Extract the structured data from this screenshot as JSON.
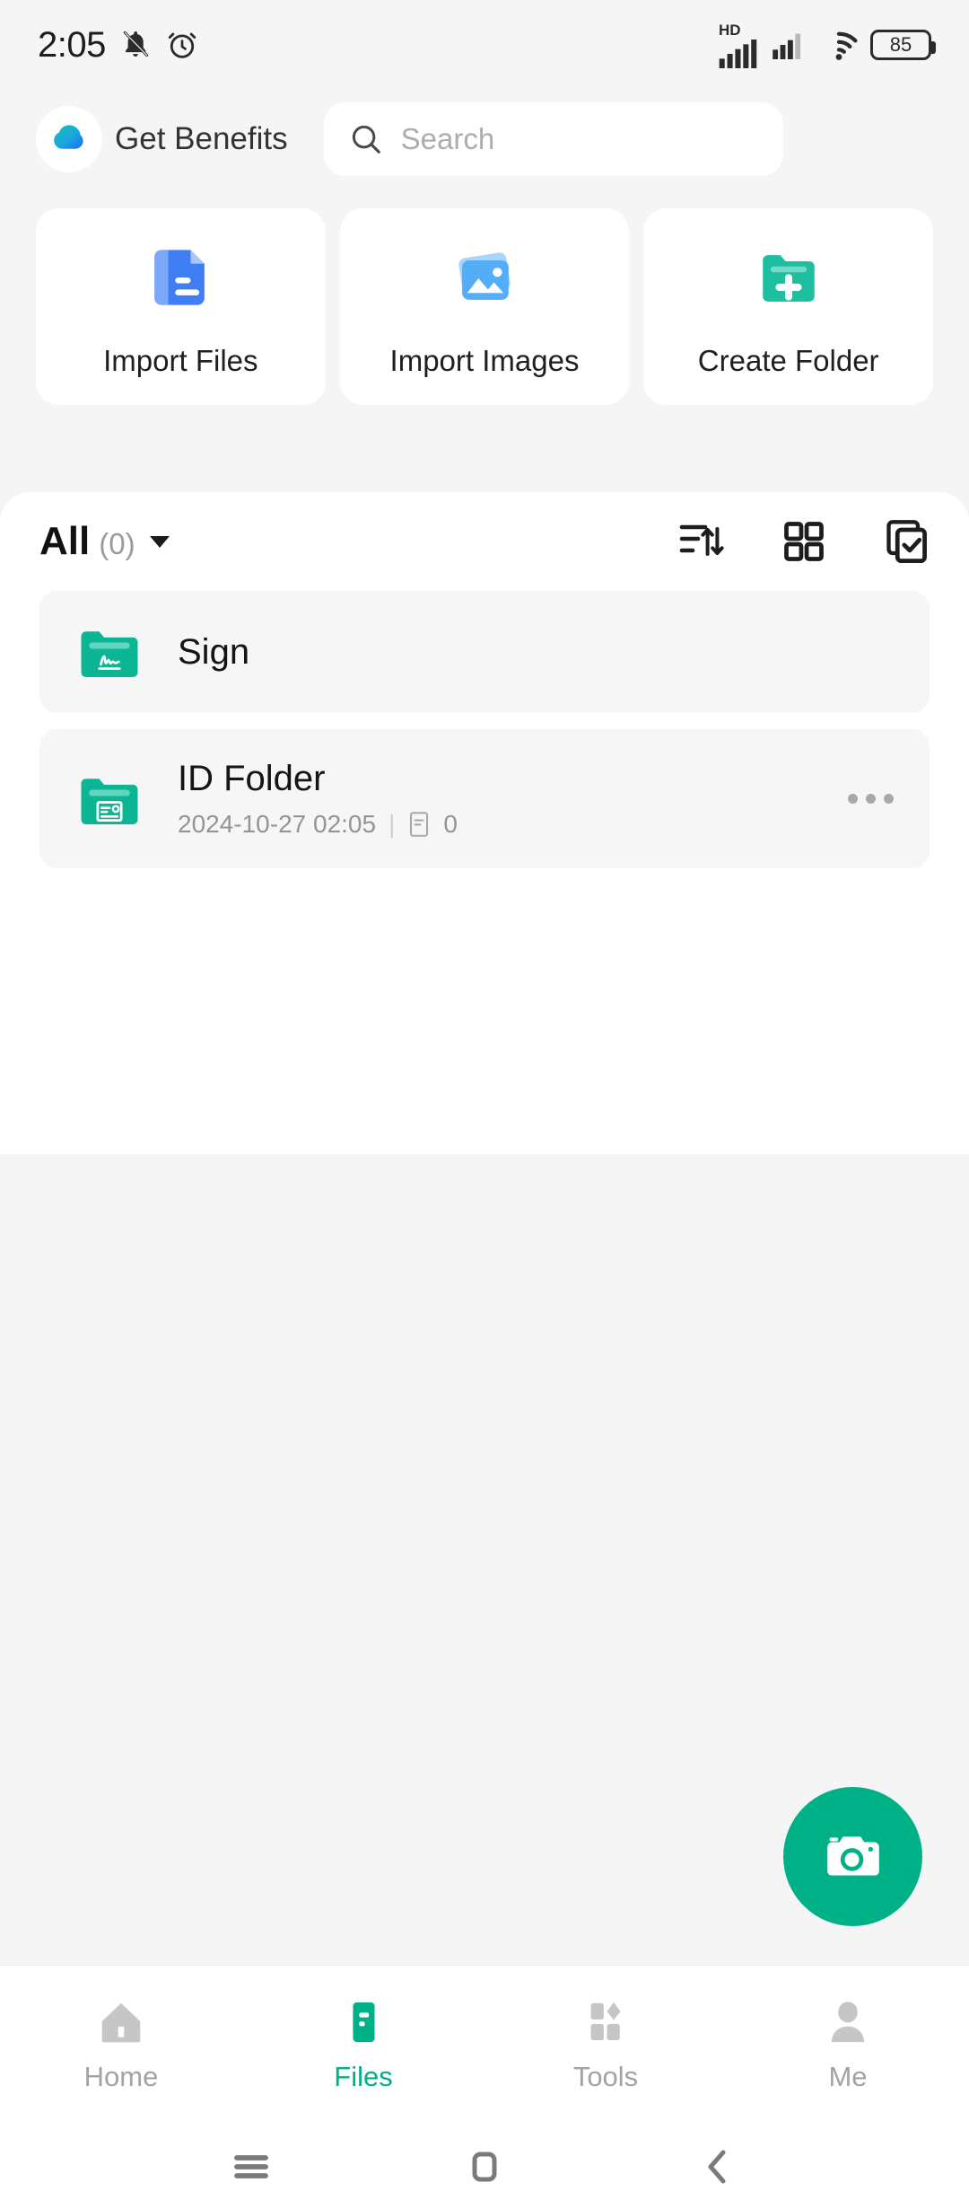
{
  "status_bar": {
    "time": "2:05",
    "left_icons": [
      "silent-bell-icon",
      "alarm-icon"
    ],
    "network_label": "HD",
    "right_icons": [
      "signal-bars-icon",
      "signal-bars-2-icon",
      "wifi-icon"
    ],
    "battery_level": "85"
  },
  "header": {
    "brand_icon": "cloud-icon",
    "brand_label": "Get Benefits",
    "search_placeholder": "Search",
    "search_value": "",
    "search_icon": "search-icon"
  },
  "action_cards": [
    {
      "label": "Import Files",
      "icon": "document-icon"
    },
    {
      "label": "Import Images",
      "icon": "photos-icon"
    },
    {
      "label": "Create Folder",
      "icon": "folder-plus-icon"
    }
  ],
  "filter_bar": {
    "label": "All",
    "count": "(0)",
    "caret_icon": "chevron-down-icon",
    "actions": [
      {
        "name": "sort-icon"
      },
      {
        "name": "grid-view-icon"
      },
      {
        "name": "multi-select-icon"
      }
    ]
  },
  "files": [
    {
      "name": "Sign",
      "icon": "folder-sign-icon",
      "meta_date": "",
      "meta_count": "",
      "has_meta": false,
      "has_menu": false
    },
    {
      "name": "ID Folder",
      "icon": "folder-id-icon",
      "meta_date": "2024-10-27 02:05",
      "meta_divider": "|",
      "meta_count": "0",
      "meta_count_icon": "file-icon",
      "has_meta": true,
      "has_menu": true,
      "menu_icon": "more-options-icon"
    }
  ],
  "fab": {
    "icon": "camera-icon"
  },
  "bottom_nav": [
    {
      "label": "Home",
      "icon": "home-icon",
      "active": false
    },
    {
      "label": "Files",
      "icon": "files-icon",
      "active": true
    },
    {
      "label": "Tools",
      "icon": "tools-icon",
      "active": false
    },
    {
      "label": "Me",
      "icon": "person-icon",
      "active": false
    }
  ],
  "android_nav": [
    {
      "name": "recents-icon"
    },
    {
      "name": "home-square-icon"
    },
    {
      "name": "back-icon"
    }
  ],
  "colors": {
    "accent_green": "#00b187",
    "blue_doc": "#3f7ef5",
    "blue_image": "#54aef7",
    "background": "#f5f5f5",
    "panel": "#ffffff",
    "row": "#f6f6f6"
  }
}
